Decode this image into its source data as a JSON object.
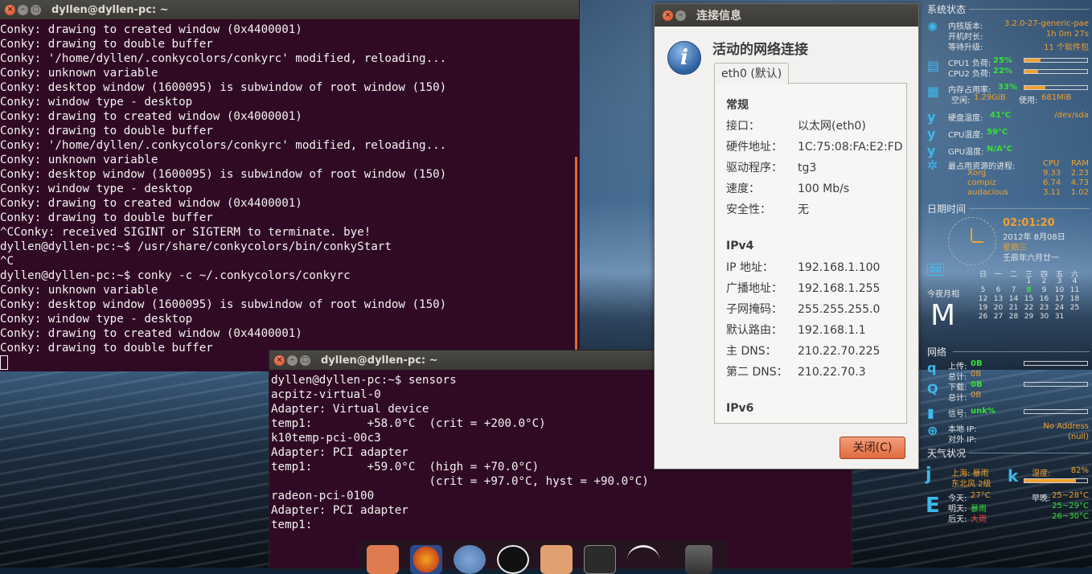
{
  "terminal1": {
    "title": "dyllen@dyllen-pc: ~",
    "lines": [
      "Conky: drawing to created window (0x4400001)",
      "Conky: drawing to double buffer",
      "Conky: '/home/dyllen/.conkycolors/conkyrc' modified, reloading...",
      "Conky: unknown variable",
      "Conky: desktop window (1600095) is subwindow of root window (150)",
      "Conky: window type - desktop",
      "Conky: drawing to created window (0x4000001)",
      "Conky: drawing to double buffer",
      "Conky: '/home/dyllen/.conkycolors/conkyrc' modified, reloading...",
      "Conky: unknown variable",
      "Conky: desktop window (1600095) is subwindow of root window (150)",
      "Conky: window type - desktop",
      "Conky: drawing to created window (0x4400001)",
      "Conky: drawing to double buffer",
      "^CConky: received SIGINT or SIGTERM to terminate. bye!",
      "dyllen@dyllen-pc:~$ /usr/share/conkycolors/bin/conkyStart",
      "^C",
      "dyllen@dyllen-pc:~$ conky -c ~/.conkycolors/conkyrc",
      "Conky: unknown variable",
      "Conky: desktop window (1600095) is subwindow of root window (150)",
      "Conky: window type - desktop",
      "Conky: drawing to created window (0x4400001)",
      "Conky: drawing to double buffer"
    ]
  },
  "terminal2": {
    "title": "dyllen@dyllen-pc: ~",
    "lines": [
      "dyllen@dyllen-pc:~$ sensors",
      "acpitz-virtual-0",
      "Adapter: Virtual device",
      "temp1:        +58.0°C  (crit = +200.0°C)",
      "",
      "k10temp-pci-00c3",
      "Adapter: PCI adapter",
      "temp1:        +59.0°C  (high = +70.0°C)",
      "                       (crit = +97.0°C, hyst = +90.0°C)",
      "",
      "radeon-pci-0100",
      "Adapter: PCI adapter",
      "temp1:"
    ]
  },
  "dialog": {
    "title": "连接信息",
    "heading": "活动的网络连接",
    "tab": "eth0 (默认)",
    "general_title": "常规",
    "general": [
      {
        "k": "接口：",
        "v": "以太网(eth0)"
      },
      {
        "k": "硬件地址：",
        "v": "1C:75:08:FA:E2:FD"
      },
      {
        "k": "驱动程序：",
        "v": "tg3"
      },
      {
        "k": "速度：",
        "v": "100 Mb/s"
      },
      {
        "k": "安全性：",
        "v": "无"
      }
    ],
    "ipv4_title": "IPv4",
    "ipv4": [
      {
        "k": "IP 地址：",
        "v": "192.168.1.100"
      },
      {
        "k": "广播地址：",
        "v": "192.168.1.255"
      },
      {
        "k": "子网掩码：",
        "v": "255.255.255.0"
      },
      {
        "k": "默认路由：",
        "v": "192.168.1.1"
      },
      {
        "k": "主 DNS：",
        "v": "210.22.70.225"
      },
      {
        "k": "第二 DNS：",
        "v": "210.22.70.3"
      }
    ],
    "ipv6_title": "IPv6",
    "close_label": "关闭(C)"
  },
  "conky": {
    "system_head": "系统状态",
    "kernel_label": "内核版本:",
    "kernel_value": "3.2.0-27-generic-pae",
    "uptime_label": "开机时长:",
    "uptime_value": "1h 0m 27s",
    "upgrade_label": "等待升级:",
    "upgrade_value": "11 个软件包",
    "cpu1_label": "CPU1 负荷:",
    "cpu1_value": "25%",
    "cpu2_label": "CPU2 负荷:",
    "cpu2_value": "22%",
    "mem_label": "内存占用率:",
    "mem_value": "33%",
    "free_label": "空闲:",
    "free_value": "1.29GiB",
    "used_label": "使用:",
    "used_value": "681MiB",
    "disk_temp_label": "硬盘温度:",
    "disk_temp_value": "41°C",
    "disk_dev": "/dev/sda",
    "cpu_temp_label": "CPU温度:",
    "cpu_temp_value": "59°C",
    "gpu_temp_label": "GPU温度:",
    "gpu_temp_value": "N/A°C",
    "proc_label": "最占用资源的进程:",
    "proc_cpu": "CPU",
    "proc_ram": "RAM",
    "procs": [
      {
        "name": "Xorg",
        "cpu": "9.33",
        "ram": "2.23"
      },
      {
        "name": "compiz",
        "cpu": "6.74",
        "ram": "4.73"
      },
      {
        "name": "audacious",
        "cpu": "3.11",
        "ram": "1.02"
      }
    ],
    "time_head": "日期时间",
    "time": "02:01:20",
    "date": "2012年  8月08日",
    "weekday": "星期三",
    "lunar": "壬辰年六月廿一",
    "cal_icon": "08",
    "cal_header": [
      "日",
      "一",
      "二",
      "三",
      "四",
      "五",
      "六"
    ],
    "cal_rows": [
      [
        "",
        "",
        "",
        "1",
        "2",
        "3",
        "4"
      ],
      [
        "5",
        "6",
        "7",
        "8",
        "9",
        "10",
        "11"
      ],
      [
        "12",
        "13",
        "14",
        "15",
        "16",
        "17",
        "18"
      ],
      [
        "19",
        "20",
        "21",
        "22",
        "23",
        "24",
        "25"
      ],
      [
        "26",
        "27",
        "28",
        "29",
        "30",
        "31",
        ""
      ]
    ],
    "moon_label": "今夜月相",
    "moon_glyph": "M",
    "net_head": "网络",
    "up_label": "上传:",
    "up_value": "0B",
    "up_total_label": "总计:",
    "up_total_value": "0B",
    "down_label": "下载:",
    "down_value": "0B",
    "down_total_label": "总计:",
    "down_total_value": "0B",
    "signal_label": "信号:",
    "signal_value": "unk%",
    "local_ip_label": "本地 IP:",
    "local_ip_value": "No Address",
    "ext_ip_label": "对外 IP:",
    "ext_ip_value": "(null)",
    "weather_head": "天气状况",
    "weather_city": "上海: 暴雨",
    "weather_wind": "东北风 2级",
    "humidity_label": "湿度:",
    "humidity_value": "82%",
    "today_label": "今天:",
    "today_value": "27°C",
    "tonight_label": "早晚:",
    "tonight_value": "25~28°C",
    "tomorrow_label": "明天:",
    "tomorrow_value": "暴雨",
    "tomorrow_temp": "25~29°C",
    "after_label": "后天:",
    "after_value": "大雨",
    "after_temp": "26~30°C",
    "weather_icon1": "j",
    "weather_icon2": "k",
    "weather_icon3": "E",
    "cpu1_fraction": 0.25,
    "cpu2_fraction": 0.22,
    "mem_fraction": 0.33,
    "humidity_fraction": 0.82
  },
  "colors": {
    "terminal_bg": "#300a24",
    "accent_orange": "#f0a030",
    "accent_green": "#38e038",
    "close_btn": "#e06a3e"
  }
}
